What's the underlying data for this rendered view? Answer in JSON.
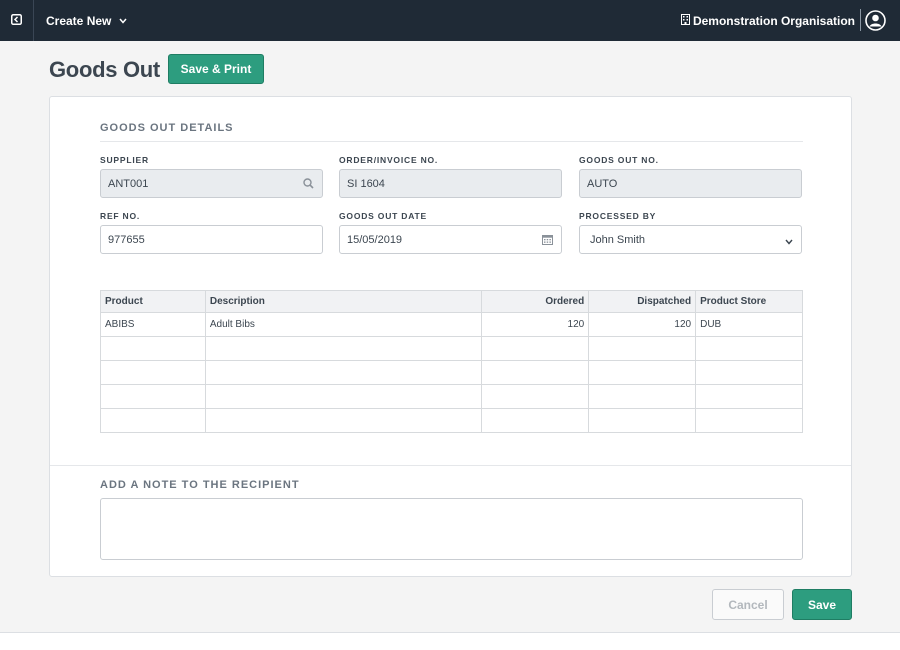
{
  "topbar": {
    "create_label": "Create New",
    "org_name": "Demonstration Organisation"
  },
  "page": {
    "title": "Goods Out",
    "save_print_label": "Save & Print"
  },
  "details": {
    "section_title": "GOODS OUT DETAILS",
    "supplier": {
      "label": "SUPPLIER",
      "value": "ANT001"
    },
    "order_invoice": {
      "label": "ORDER/INVOICE NO.",
      "value": "SI 1604"
    },
    "goods_out_no": {
      "label": "GOODS OUT NO.",
      "value": "AUTO"
    },
    "ref_no": {
      "label": "REF NO.",
      "value": "977655"
    },
    "goods_out_date": {
      "label": "GOODS OUT DATE",
      "value": "15/05/2019"
    },
    "processed_by": {
      "label": "PROCESSED BY",
      "value": "John Smith"
    }
  },
  "table": {
    "headers": [
      "Product",
      "Description",
      "Ordered",
      "Dispatched",
      "Product Store"
    ],
    "rows": [
      [
        "ABIBS",
        "Adult Bibs",
        "120",
        "120",
        "DUB"
      ],
      [
        "",
        "",
        "",
        "",
        ""
      ],
      [
        "",
        "",
        "",
        "",
        ""
      ],
      [
        "",
        "",
        "",
        "",
        ""
      ],
      [
        "",
        "",
        "",
        "",
        ""
      ]
    ]
  },
  "note": {
    "section_title": "ADD A NOTE TO THE RECIPIENT",
    "value": ""
  },
  "actions": {
    "cancel_label": "Cancel",
    "save_label": "Save"
  },
  "colors": {
    "topbar": "#1f2a36",
    "accent": "#2d9d7f"
  }
}
